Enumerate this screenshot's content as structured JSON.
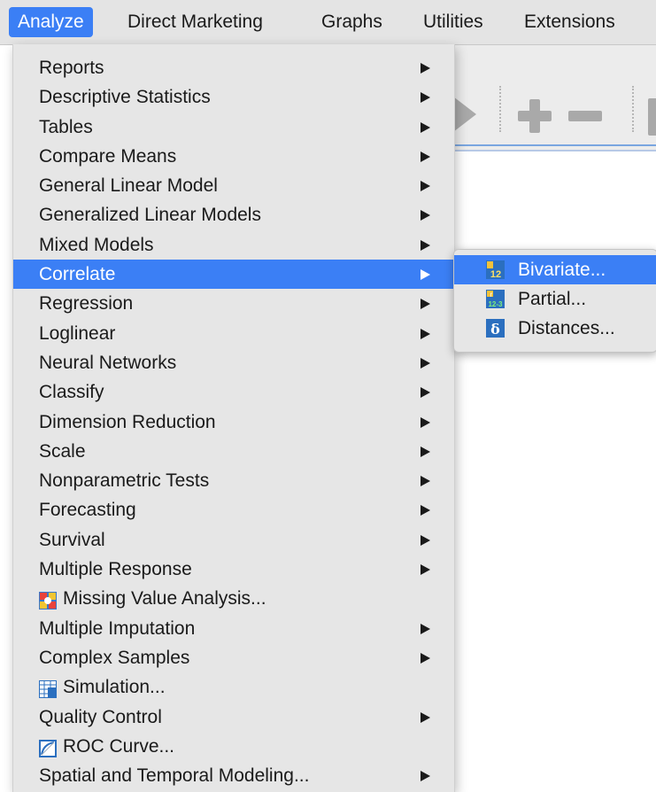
{
  "menubar": {
    "items": [
      {
        "label": "Analyze",
        "active": true
      },
      {
        "label": "Direct Marketing"
      },
      {
        "label": "Graphs"
      },
      {
        "label": "Utilities"
      },
      {
        "label": "Extensions"
      }
    ]
  },
  "analyze_menu": {
    "items": [
      {
        "label": "Reports",
        "submenu": true
      },
      {
        "label": "Descriptive Statistics",
        "submenu": true
      },
      {
        "label": "Tables",
        "submenu": true
      },
      {
        "label": "Compare Means",
        "submenu": true
      },
      {
        "label": "General Linear Model",
        "submenu": true
      },
      {
        "label": "Generalized Linear Models",
        "submenu": true
      },
      {
        "label": "Mixed Models",
        "submenu": true
      },
      {
        "label": "Correlate",
        "submenu": true,
        "highlighted": true
      },
      {
        "label": "Regression",
        "submenu": true
      },
      {
        "label": "Loglinear",
        "submenu": true
      },
      {
        "label": "Neural Networks",
        "submenu": true
      },
      {
        "label": "Classify",
        "submenu": true
      },
      {
        "label": "Dimension Reduction",
        "submenu": true
      },
      {
        "label": "Scale",
        "submenu": true
      },
      {
        "label": "Nonparametric Tests",
        "submenu": true
      },
      {
        "label": "Forecasting",
        "submenu": true
      },
      {
        "label": "Survival",
        "submenu": true
      },
      {
        "label": "Multiple Response",
        "submenu": true
      },
      {
        "label": "Missing Value Analysis...",
        "icon": "missing-value-icon"
      },
      {
        "label": "Multiple Imputation",
        "submenu": true
      },
      {
        "label": "Complex Samples",
        "submenu": true
      },
      {
        "label": "Simulation...",
        "icon": "simulation-icon"
      },
      {
        "label": "Quality Control",
        "submenu": true
      },
      {
        "label": "ROC Curve...",
        "icon": "roc-curve-icon"
      },
      {
        "label": "Spatial and Temporal Modeling...",
        "submenu": true
      }
    ]
  },
  "correlate_submenu": {
    "items": [
      {
        "label": "Bivariate...",
        "icon": "bivariate-icon",
        "highlighted": true
      },
      {
        "label": "Partial...",
        "icon": "partial-icon"
      },
      {
        "label": "Distances...",
        "icon": "distances-icon"
      }
    ]
  },
  "icon_text": {
    "bivariate": "12",
    "partial_top": "r",
    "partial_bottom": "12-3",
    "distances": "δ"
  },
  "colors": {
    "highlight": "#3b7ff5",
    "menu_bg": "#e6e6e6",
    "menubar_bg": "#e4e4e4"
  }
}
